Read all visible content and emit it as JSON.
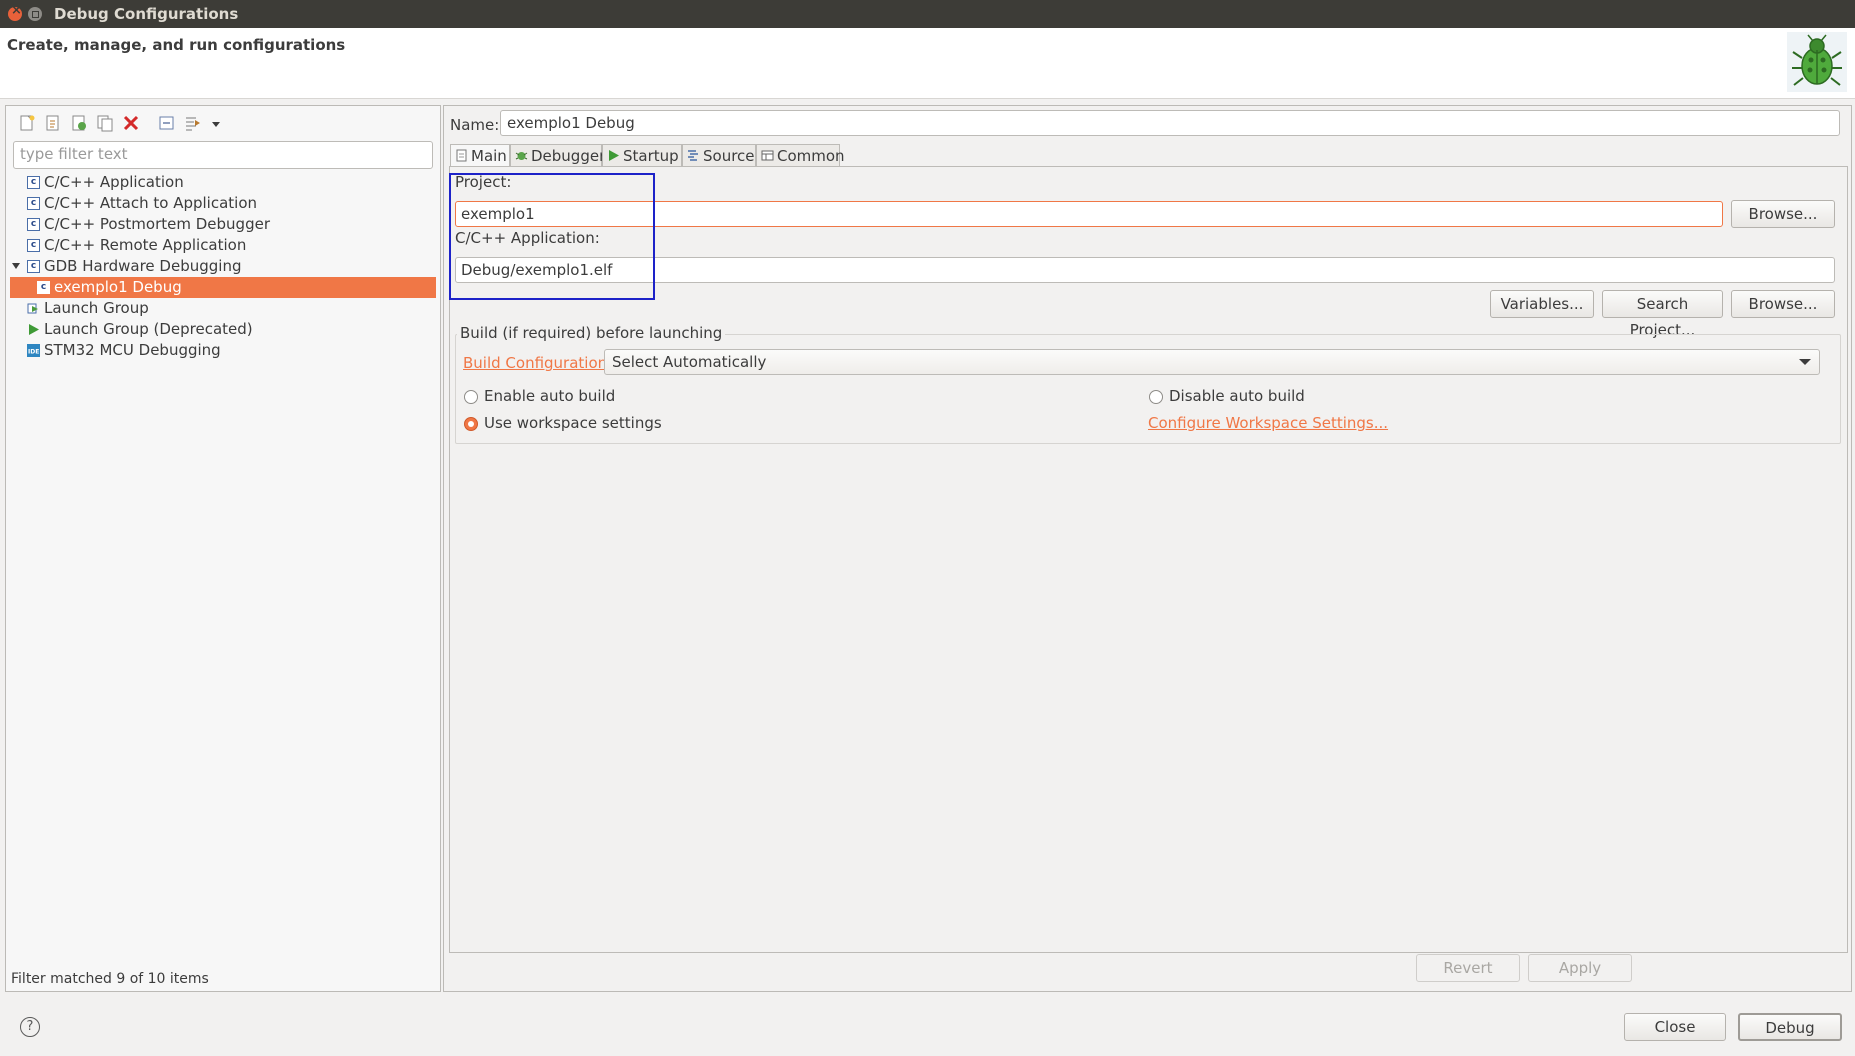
{
  "window": {
    "title": "Debug Configurations"
  },
  "header": {
    "description": "Create, manage, and run configurations"
  },
  "left": {
    "toolbar": [
      "new-config-icon",
      "duplicate-icon",
      "export-icon",
      "copy-icon",
      "delete-icon",
      "collapse-all-icon",
      "filter-icon",
      "dropdown-arrow-icon"
    ],
    "filter_placeholder": "type filter text",
    "tree": [
      {
        "label": "C/C++ Application",
        "icon": "c-icon",
        "level": 0
      },
      {
        "label": "C/C++ Attach to Application",
        "icon": "c-icon",
        "level": 0
      },
      {
        "label": "C/C++ Postmortem Debugger",
        "icon": "c-icon",
        "level": 0
      },
      {
        "label": "C/C++ Remote Application",
        "icon": "c-icon",
        "level": 0
      },
      {
        "label": "GDB Hardware Debugging",
        "icon": "c-icon",
        "level": 0,
        "expanded": true
      },
      {
        "label": "exemplo1 Debug",
        "icon": "c-icon",
        "level": 1,
        "selected": true
      },
      {
        "label": "Launch Group",
        "icon": "launch-group-icon",
        "level": 0
      },
      {
        "label": "Launch Group (Deprecated)",
        "icon": "play-icon",
        "level": 0
      },
      {
        "label": "STM32 MCU Debugging",
        "icon": "ide-icon",
        "level": 0
      }
    ],
    "status": "Filter matched 9 of 10 items"
  },
  "right": {
    "name_label": "Name:",
    "name_value": "exemplo1 Debug",
    "tabs": [
      {
        "label": "Main",
        "icon": "document-icon",
        "active": true
      },
      {
        "label": "Debugger",
        "icon": "debugger-icon"
      },
      {
        "label": "Startup",
        "icon": "play-icon"
      },
      {
        "label": "Source",
        "icon": "source-icon"
      },
      {
        "label": "Common",
        "icon": "common-icon"
      }
    ],
    "main": {
      "project_label": "Project:",
      "project_value": "exemplo1",
      "browse_label": "Browse...",
      "app_label": "C/C++ Application:",
      "app_value": "Debug/exemplo1.elf",
      "variables_label": "Variables...",
      "search_project_label": "Search Project...",
      "browse2_label": "Browse...",
      "build_group_title": "Build (if required) before launching",
      "build_config_link": "Build Configuration:",
      "build_config_value": "Select Automatically",
      "enable_auto_build": "Enable auto build",
      "disable_auto_build": "Disable auto build",
      "use_workspace": "Use workspace settings",
      "configure_workspace_link": "Configure Workspace Settings..."
    },
    "revert_label": "Revert",
    "apply_label": "Apply"
  },
  "footer": {
    "help_glyph": "?",
    "close_label": "Close",
    "debug_label": "Debug"
  },
  "colors": {
    "accent": "#f07746",
    "highlight_box": "#1d22c8",
    "titlebar": "#3d3c37"
  }
}
